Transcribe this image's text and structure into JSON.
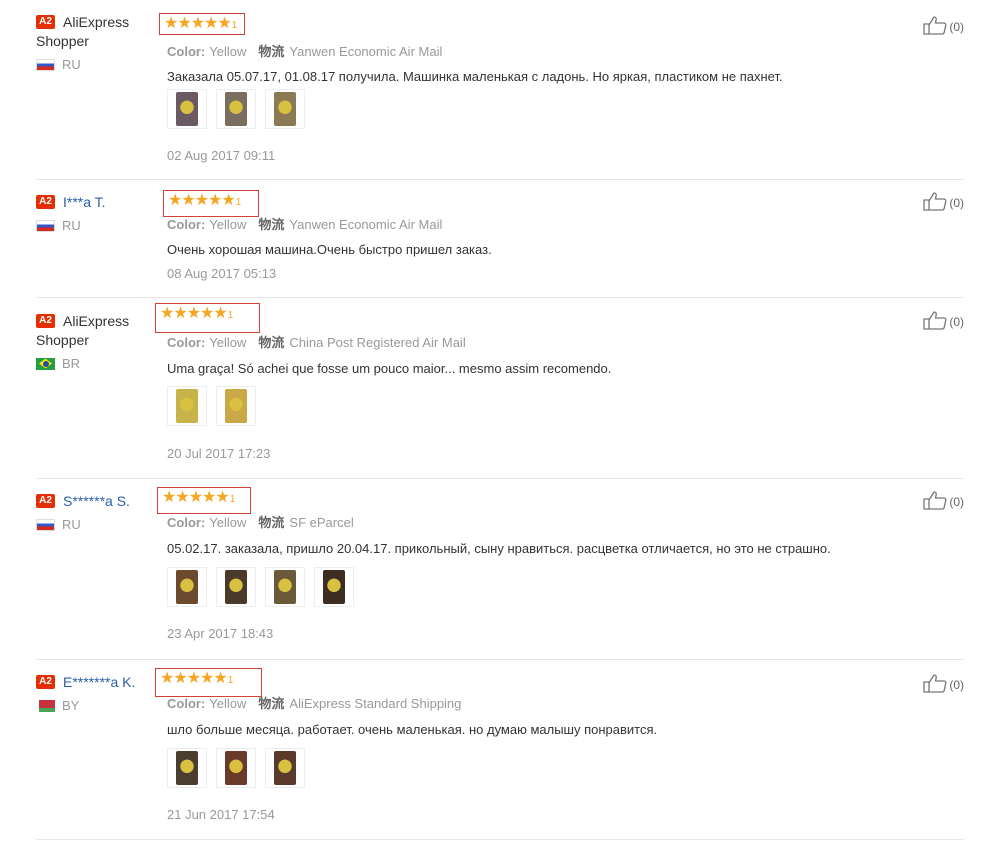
{
  "reviews": [
    {
      "badge": "A2",
      "name_line1": "AliExpress",
      "name_line2": "Shopper",
      "masked": false,
      "country": "RU",
      "flag": "ru",
      "rating": 5,
      "stars": "★★★★★",
      "color_label": "Color:",
      "color_value": "Yellow",
      "shipping_label": "物流",
      "shipping_value": "Yanwen Economic Air Mail",
      "text": "Заказала 05.07.17, 01.08.17 получила. Машинка маленькая с ладонь. Но яркая, пластиком не пахнет.",
      "photo_colors": [
        "#6b5a63",
        "#7a6e60",
        "#8c7a54"
      ],
      "date": "02 Aug 2017 09:11",
      "helpful_count": "(0)"
    },
    {
      "badge": "A2",
      "name_line1": "I***a T.",
      "name_line2": "",
      "masked": true,
      "country": "RU",
      "flag": "ru",
      "rating": 5,
      "stars": "★★★★★",
      "color_label": "Color:",
      "color_value": "Yellow",
      "shipping_label": "物流",
      "shipping_value": "Yanwen Economic Air Mail",
      "text": "Очень хорошая машина.Очень быстро пришел заказ.",
      "photo_colors": [],
      "date": "08 Aug 2017 05:13",
      "helpful_count": "(0)"
    },
    {
      "badge": "A2",
      "name_line1": "AliExpress",
      "name_line2": "Shopper",
      "masked": false,
      "country": "BR",
      "flag": "br",
      "rating": 5,
      "stars": "★★★★★",
      "color_label": "Color:",
      "color_value": "Yellow",
      "shipping_label": "物流",
      "shipping_value": "China Post Registered Air Mail",
      "text": "Uma graça! Só achei que fosse um pouco maior... mesmo assim recomendo.",
      "photo_colors": [
        "#c8b24a",
        "#c9a848"
      ],
      "date": "20 Jul 2017 17:23",
      "helpful_count": "(0)"
    },
    {
      "badge": "A2",
      "name_line1": "S******a S.",
      "name_line2": "",
      "masked": true,
      "country": "RU",
      "flag": "ru",
      "rating": 5,
      "stars": "★★★★★",
      "color_label": "Color:",
      "color_value": "Yellow",
      "shipping_label": "物流",
      "shipping_value": "SF eParcel",
      "text": "05.02.17. заказала, пришло 20.04.17. прикольный, сыну нравиться. расцветка отличается, но это не страшно.",
      "photo_colors": [
        "#6b4a2e",
        "#4a3a2a",
        "#6a5a3a",
        "#3e2e22"
      ],
      "date": "23 Apr 2017 18:43",
      "helpful_count": "(0)"
    },
    {
      "badge": "A2",
      "name_line1": "E*******a K.",
      "name_line2": "",
      "masked": true,
      "country": "BY",
      "flag": "by",
      "rating": 5,
      "stars": "★★★★★",
      "color_label": "Color:",
      "color_value": "Yellow",
      "shipping_label": "物流",
      "shipping_value": "AliExpress Standard Shipping",
      "text": "шло больше месяца. работает. очень маленькая. но думаю малышу понравится.",
      "photo_colors": [
        "#4a3e30",
        "#6a3a2a",
        "#5a3a2a"
      ],
      "date": "21 Jun 2017 17:54",
      "helpful_count": "(0)"
    }
  ]
}
